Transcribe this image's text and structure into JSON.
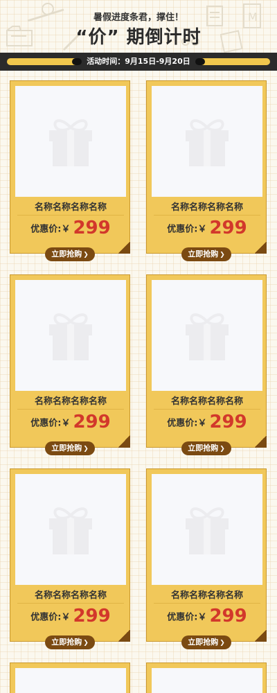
{
  "header": {
    "subtitle": "暑假进度条君，撑住！",
    "title": "“价” 期倒计时"
  },
  "timebar": {
    "text": "活动时间：9月15日-9月20日"
  },
  "colors": {
    "card_bg": "#f1c85a",
    "price": "#d2382b",
    "button_bg": "#7b4a12",
    "bar_bg": "#2b2b2b"
  },
  "products": [
    {
      "name": "名称名称名称名称",
      "price_label": "优惠价:￥",
      "price": "299",
      "button": "立即抢购",
      "image_icon": "gift-icon"
    },
    {
      "name": "名称名称名称名称",
      "price_label": "优惠价:￥",
      "price": "299",
      "button": "立即抢购",
      "image_icon": "gift-icon"
    },
    {
      "name": "名称名称名称名称",
      "price_label": "优惠价:￥",
      "price": "299",
      "button": "立即抢购",
      "image_icon": "gift-icon"
    },
    {
      "name": "名称名称名称名称",
      "price_label": "优惠价:￥",
      "price": "299",
      "button": "立即抢购",
      "image_icon": "gift-icon"
    },
    {
      "name": "名称名称名称名称",
      "price_label": "优惠价:￥",
      "price": "299",
      "button": "立即抢购",
      "image_icon": "gift-icon"
    },
    {
      "name": "名称名称名称名称",
      "price_label": "优惠价:￥",
      "price": "299",
      "button": "立即抢购",
      "image_icon": "gift-icon"
    }
  ]
}
